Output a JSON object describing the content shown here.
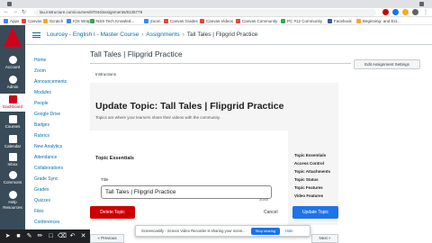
{
  "browser": {
    "url": "lau.instructure.com/courses/87044/assignments/8135779",
    "bookmarks": [
      {
        "label": "Apps",
        "color": "#4285f4"
      },
      {
        "label": "Canvas",
        "color": "#e8453c"
      },
      {
        "label": "Scratch",
        "color": "#f9a825"
      },
      {
        "label": "IOS Wrap",
        "color": "#4285f4"
      },
      {
        "label": "NSS Tech Knowled...",
        "color": "#34a853"
      },
      {
        "label": "Zoom",
        "color": "#2d8cff"
      },
      {
        "label": "Canvas Guides",
        "color": "#e8453c"
      },
      {
        "label": "Canvas Videos",
        "color": "#e8453c"
      },
      {
        "label": "Canvas Community",
        "color": "#e8453c"
      },
      {
        "label": "PC #12 Community",
        "color": "#34a853"
      },
      {
        "label": "Facebook",
        "color": "#3b5998"
      },
      {
        "label": "Beginning- and Ext...",
        "color": "#f9a825"
      }
    ]
  },
  "global_nav": {
    "items": [
      {
        "label": "Account"
      },
      {
        "label": "Admin"
      },
      {
        "label": "Dashboard"
      },
      {
        "label": "Courses"
      },
      {
        "label": "Calendar"
      },
      {
        "label": "Inbox"
      },
      {
        "label": "Commons"
      },
      {
        "label": "Help Resources"
      }
    ]
  },
  "breadcrumb": {
    "items": [
      "Lourcey - English I - Master Course",
      "Assignments",
      "Tall Tales | Flipgrid Practice"
    ]
  },
  "course_nav": {
    "items": [
      "Home",
      "Zoom",
      "Announcements",
      "Modules",
      "People",
      "Google Drive",
      "Badges",
      "Rubrics",
      "New Analytics",
      "Attendance",
      "Collaborations",
      "Grade Sync",
      "Grades",
      "Quizzes",
      "Files",
      "Conferences"
    ]
  },
  "page": {
    "title": "Tall Tales | Flipgrid Practice",
    "edit_settings": "Edit Assignment Settings",
    "instructions_label": "Instructions"
  },
  "embed": {
    "heading": "Update Topic: Tall Tales | Flipgrid Practice",
    "subheading": "Topics are where your learners share their videos with the community.",
    "section": "Topic Essentials",
    "title_label": "Title",
    "title_value": "Tall Tales | Flipgrid Practice",
    "char_count": "30/85",
    "delete_button": "Delete Topic",
    "cancel_button": "Cancel",
    "update_button": "Update Topic",
    "side_links": [
      "Topic Essentials",
      "Access Control",
      "Topic Attachments",
      "Topic Status",
      "Topic Features",
      "Video Features"
    ]
  },
  "footer": {
    "previous": "« Previous",
    "next": "Next »"
  },
  "screencast": {
    "message": "Screencastify - Screen Video Recorder is sharing your scree...",
    "stop_button": "Stop sharing",
    "hide_button": "Hide"
  }
}
